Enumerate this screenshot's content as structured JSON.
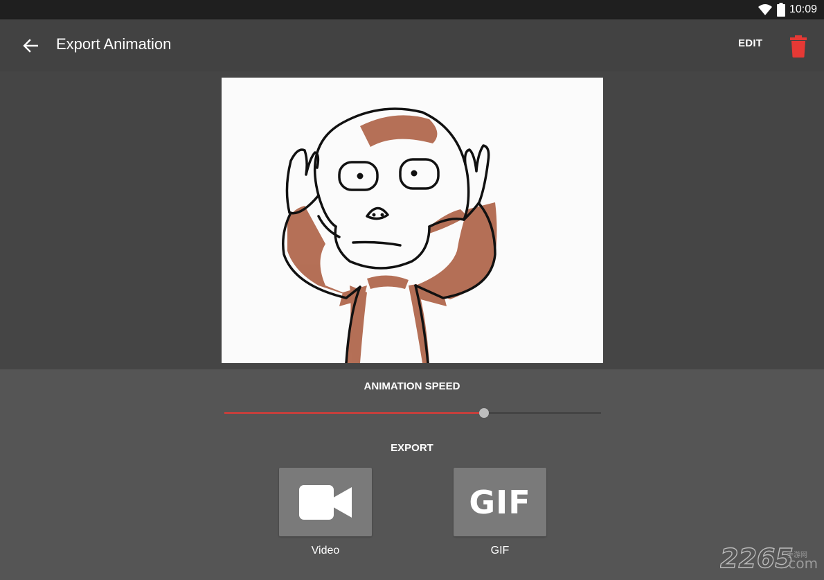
{
  "status_bar": {
    "time": "10:09",
    "icons": [
      "wifi-icon",
      "battery-icon"
    ]
  },
  "app_bar": {
    "title": "Export Animation",
    "edit_label": "EDIT",
    "icons": [
      "back-arrow-icon",
      "trash-icon"
    ],
    "delete_color": "#e53935"
  },
  "preview": {
    "subject": "monkey-drawing"
  },
  "animation_speed": {
    "label": "ANIMATION SPEED",
    "value_fraction": 0.69,
    "accent_color": "#e53935"
  },
  "export": {
    "label": "EXPORT",
    "options": [
      {
        "caption": "Video",
        "icon": "video-camera-icon"
      },
      {
        "caption": "GIF",
        "glyph": "GIF"
      }
    ]
  },
  "watermark": {
    "text": "2265",
    "suffix": ".com",
    "cn": "手游网"
  }
}
